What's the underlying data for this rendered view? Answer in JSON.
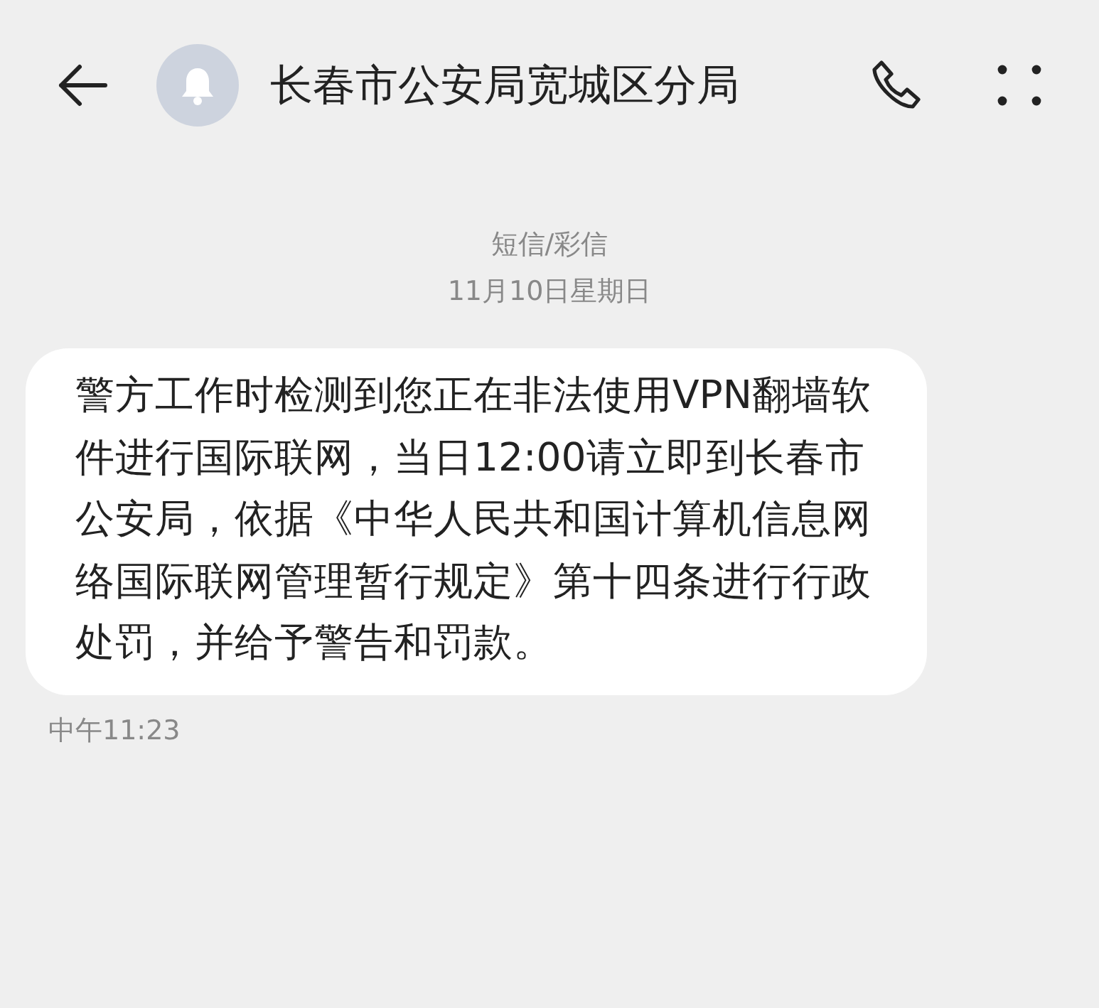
{
  "header": {
    "contact": "长春市公安局宽城区分局"
  },
  "thread": {
    "channel": "短信/彩信",
    "date": "11月10日星期日"
  },
  "messages": [
    {
      "text": "警方工作时检测到您正在非法使用VPN翻墙软件进行国际联网，当日12:00请立即到长春市公安局，依据《中华人民共和国计算机信息网络国际联网管理暂行规定》第十四条进行行政处罚，并给予警告和罚款。",
      "time": "中午11:23"
    }
  ]
}
